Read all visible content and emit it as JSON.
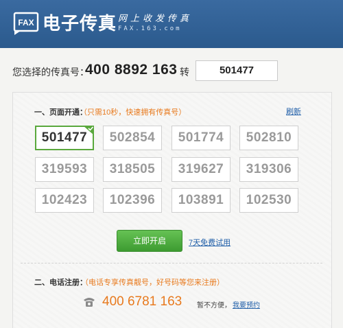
{
  "header": {
    "logo_badge": "FAX",
    "title": "电子传真",
    "slogan": "网上收发传真",
    "domain": "FAX.163.com"
  },
  "selection": {
    "label": "您选择的传真号：",
    "main_number": "400 8892 163",
    "connector": "转",
    "extension": "501477"
  },
  "section_open": {
    "title": "一、页面开通：",
    "note": "（只需10秒，快速拥有传真号）",
    "refresh_label": "刷新",
    "numbers": [
      "501477",
      "502854",
      "501774",
      "502810",
      "319593",
      "318505",
      "319627",
      "319306",
      "102423",
      "102396",
      "103891",
      "102530"
    ],
    "selected_index": 0,
    "open_button_label": "立即开启",
    "trial_link_label": "7天免费试用"
  },
  "section_phone": {
    "title": "二、电话注册：",
    "note": "（电话专享传真靓号，好号码等您来注册）",
    "phone_number": "400 6781 163",
    "hint": "暂不方便，",
    "reserve_link_label": "我要预约"
  },
  "colors": {
    "header_blue": "#2f5e92",
    "accent_orange": "#e87a1e",
    "link_blue": "#1f5ea8",
    "button_green": "#4fae3d",
    "selected_border": "#59a83c"
  }
}
